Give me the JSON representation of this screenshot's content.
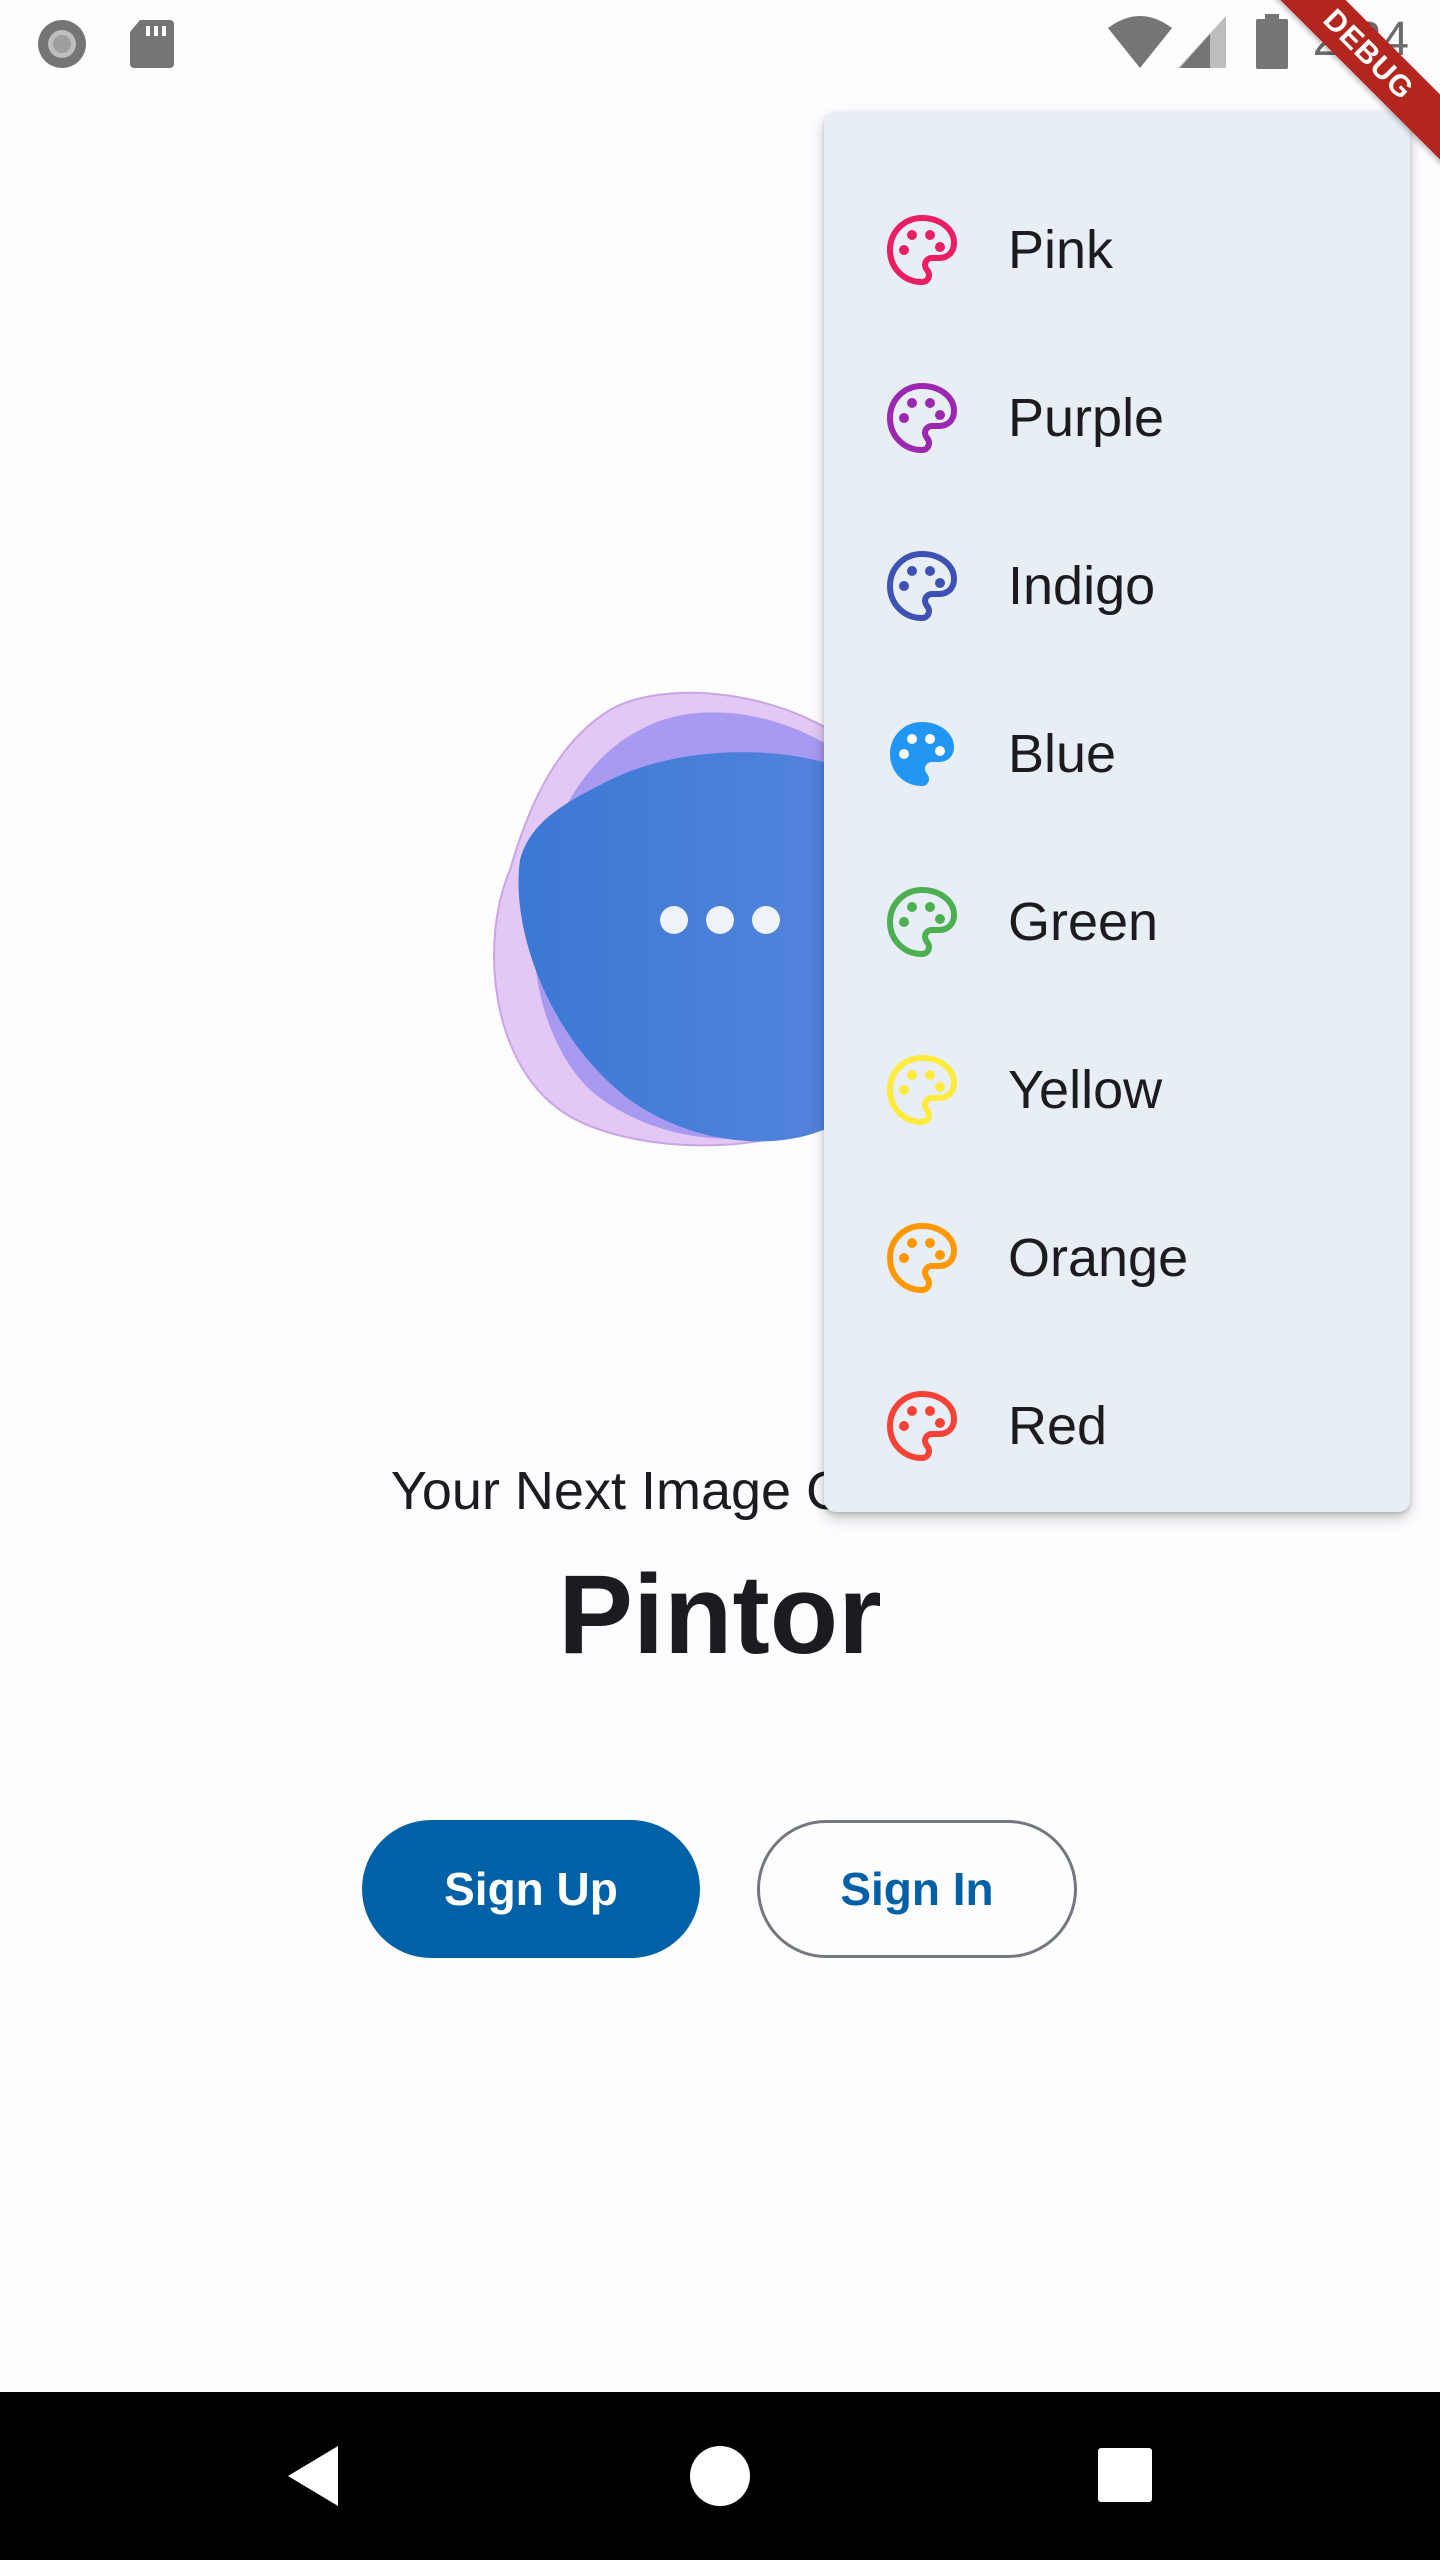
{
  "status_bar": {
    "time": "2:34"
  },
  "debug_banner": {
    "label": "DEBUG"
  },
  "hero": {
    "loading_indicator": "•••"
  },
  "welcome": {
    "tagline": "Your Next Image Generator",
    "app_name": "Pintor"
  },
  "buttons": {
    "sign_up": "Sign Up",
    "sign_in": "Sign In"
  },
  "color_menu": {
    "items": [
      {
        "label": "Pink",
        "color": "#e91e63",
        "icon": "palette-outline-icon"
      },
      {
        "label": "Purple",
        "color": "#9c27b0",
        "icon": "palette-outline-icon"
      },
      {
        "label": "Indigo",
        "color": "#3f51b5",
        "icon": "palette-outline-icon"
      },
      {
        "label": "Blue",
        "color": "#2196f3",
        "icon": "palette-filled-icon",
        "selected": true
      },
      {
        "label": "Green",
        "color": "#4caf50",
        "icon": "palette-outline-icon"
      },
      {
        "label": "Yellow",
        "color": "#ffeb3b",
        "icon": "palette-outline-icon"
      },
      {
        "label": "Orange",
        "color": "#ff9800",
        "icon": "palette-outline-icon"
      },
      {
        "label": "Red",
        "color": "#f44336",
        "icon": "palette-outline-icon"
      }
    ]
  },
  "theme": {
    "primary": "#0061a6",
    "menu_background": "#e8eef6",
    "background": "#fdfcff"
  }
}
